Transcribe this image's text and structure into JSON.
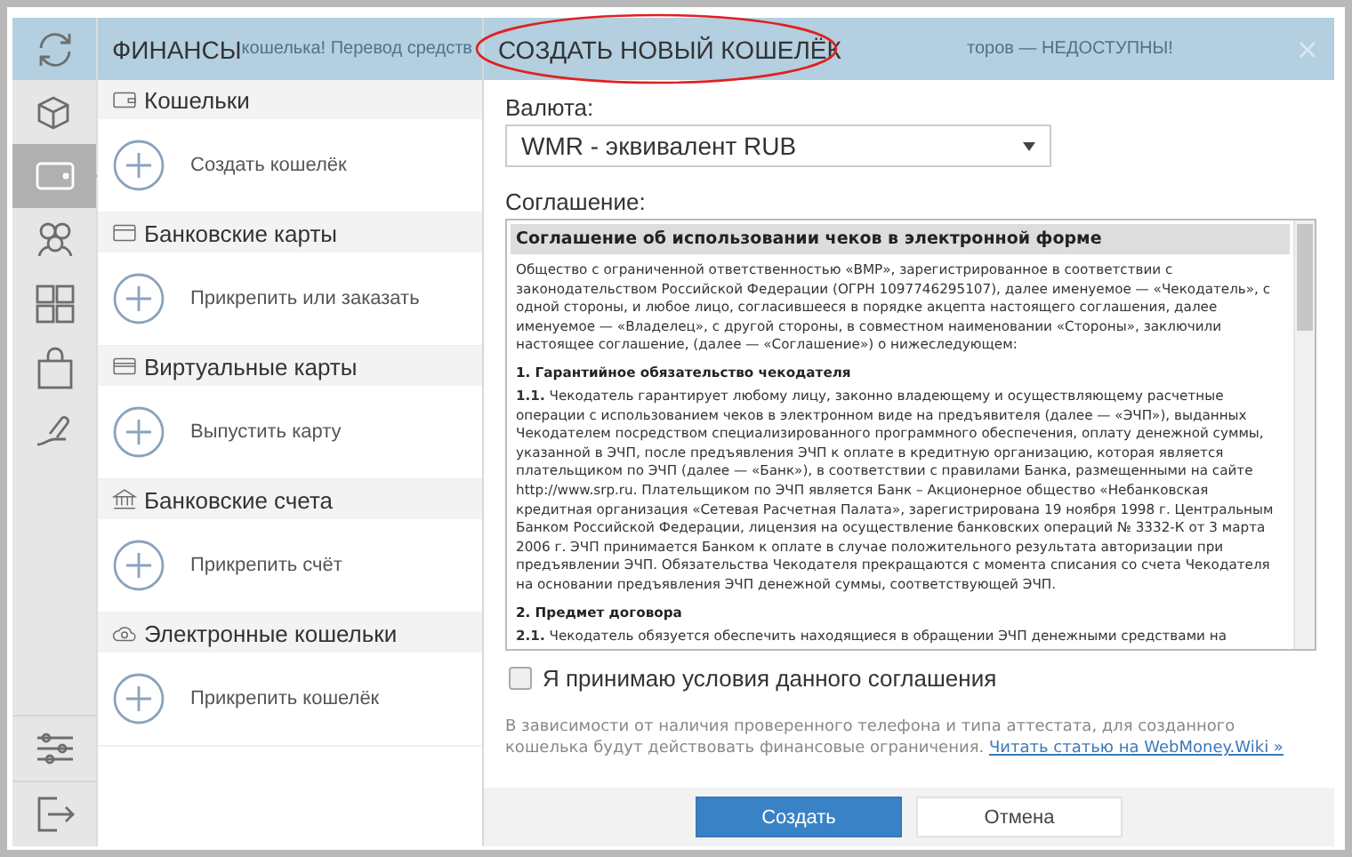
{
  "banner": {
    "fragments": [
      "кошелька! Перевод средств",
      "торов — НЕДОСТУПНЫ!"
    ]
  },
  "rail": {
    "items": [
      {
        "selected": false
      },
      {
        "selected": true
      },
      {
        "selected": false
      },
      {
        "selected": false
      },
      {
        "selected": false
      },
      {
        "selected": false
      }
    ]
  },
  "menu": {
    "title": "ФИНАНСЫ",
    "sections": [
      {
        "title": "Кошельки",
        "action": "Создать кошелёк"
      },
      {
        "title": "Банковские карты",
        "action": "Прикрепить или заказать"
      },
      {
        "title": "Виртуальные карты",
        "action": "Выпустить карту"
      },
      {
        "title": "Банковские счета",
        "action": "Прикрепить счёт"
      },
      {
        "title": "Электронные кошельки",
        "action": "Прикрепить кошелёк"
      }
    ]
  },
  "dialog": {
    "title": "СОЗДАТЬ НОВЫЙ КОШЕЛЁК",
    "currency_label": "Валюта:",
    "currency": "WMR - эквивалент RUB",
    "agreement_label": "Соглашение:",
    "agreement": {
      "title": "Соглашение об использовании чеков в электронной форме",
      "blocks": [
        {
          "kind": "p",
          "text": "Общество с ограниченной ответственностью «ВМР», зарегистрированное в соответствии с законодательством Российской Федерации (ОГРН 1097746295107), далее именуемое — «Чекодатель», с одной стороны, и любое лицо, согласившееся в порядке акцепта настоящего соглашения, далее именуемое — «Владелец», с другой стороны, в совместном наименовании «Стороны», заключили настоящее соглашение, (далее — «Соглашение») о нижеследующем:"
        },
        {
          "kind": "h",
          "text": "1. Гарантийное обязательство чекодателя"
        },
        {
          "kind": "p",
          "text": "**1.1.** Чекодатель гарантирует любому лицу, законно владеющему и осуществляющему расчетные операции с использованием чеков в электронном виде на предъявителя (далее — «ЭЧП»), выданных Чекодателем посредством специализированного программного обеспечения, оплату денежной суммы, указанной в ЭЧП, после предъявления ЭЧП к оплате в кредитную организацию, которая является плательщиком по ЭЧП (далее — «Банк»), в соответствии с правилами Банка, размещенными на сайте http://www.srp.ru. Плательщиком по ЭЧП является Банк – Акционерное общество «Небанковская кредитная организация «Сетевая Расчетная Палата», зарегистрирована 19 ноября 1998 г. Центральным Банком Российской Федерации, лицензия на осуществление банковских операций № 3332-К от 3 марта 2006 г. ЭЧП принимается Банком к оплате в случае положительного результата авторизации при предъявлении ЭЧП. Обязательства Чекодателя прекращаются с момента списания со счета Чекодателя на основании предъявления ЭЧП денежной суммы, соответствующей ЭЧП."
        },
        {
          "kind": "h",
          "text": "2. Предмет договора"
        },
        {
          "kind": "p",
          "text": "**2.1.** Чекодатель обязуется обеспечить находящиеся в обращении ЭЧП денежными средствами на"
        }
      ]
    },
    "accept": {
      "label": "Я принимаю условия данного соглашения",
      "checked": false
    },
    "note": "В зависимости от наличия проверенного телефона и типа аттестата, для созданного кошелька будут действовать финансовые ограничения.",
    "note_link": "Читать статью на WebMoney.Wiki »",
    "buttons": [
      {
        "label": "Создать",
        "kind": "primary"
      },
      {
        "label": "Отмена",
        "kind": "secondary"
      }
    ]
  }
}
